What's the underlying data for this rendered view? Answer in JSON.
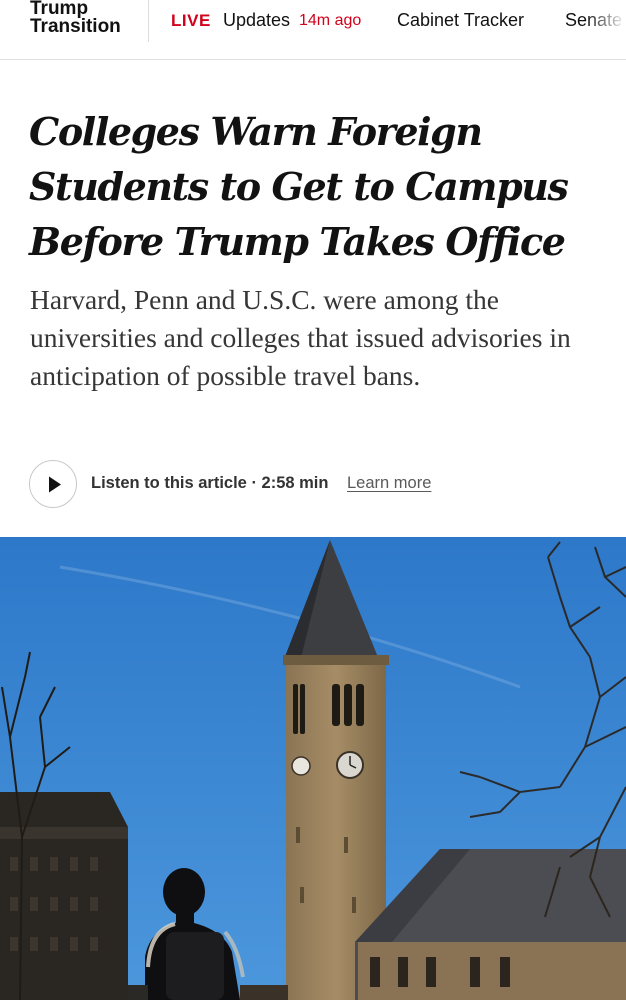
{
  "nav": {
    "section_line1": "Trump",
    "section_line2": "Transition",
    "live_label": "LIVE",
    "updates_label": "Updates",
    "updated_ago": "14m ago",
    "items": [
      "Cabinet Tracker",
      "Senate"
    ]
  },
  "article": {
    "headline": "Colleges Warn Foreign Students to Get to Campus Before Trump Takes Office",
    "summary": "Harvard, Penn and U.S.C. were among the universities and colleges that issued advisories in anticipation of possible travel bans."
  },
  "audio": {
    "listen_label": "Listen to this article · 2:58 min",
    "learn_more": "Learn more"
  },
  "colors": {
    "live_red": "#d0021b",
    "sky": "#2f7fd0"
  },
  "icons": {
    "play": "play-icon"
  }
}
